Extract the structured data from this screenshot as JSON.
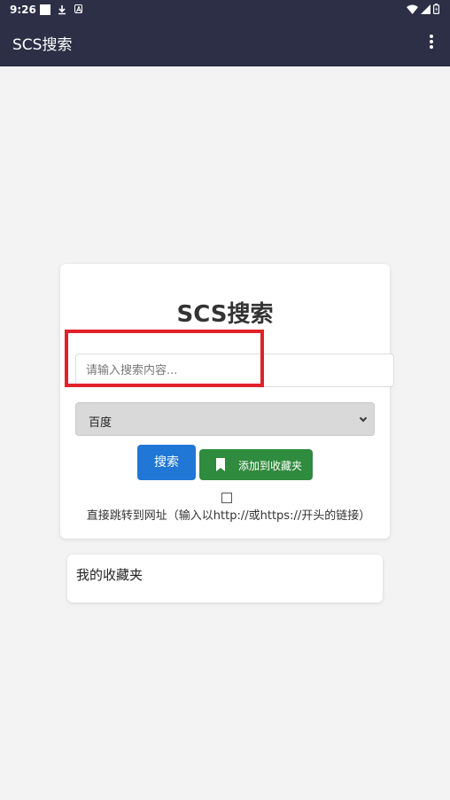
{
  "status_bar": {
    "time": "9:26",
    "left_icons": [
      "notification-square-icon",
      "download-icon",
      "font-a-icon"
    ],
    "right_icons": [
      "wifi-icon",
      "signal-icon",
      "battery-icon"
    ]
  },
  "app_bar": {
    "title": "SCS搜索",
    "menu_icon": "more-vert-icon"
  },
  "search_card": {
    "title": "SCS搜索",
    "search_placeholder": "请输入搜索内容...",
    "engine_selected": "百度",
    "search_button": "搜索",
    "favorite_button": "添加到收藏夹",
    "redirect_label": "直接跳转到网址（输入以http://或https://开头的链接）"
  },
  "favorites": {
    "title": "我的收藏夹"
  },
  "colors": {
    "app_bar_bg": "#2c2f45",
    "page_bg": "#f3f3f3",
    "search_button": "#2077d6",
    "favorite_button": "#2f8b3d",
    "highlight": "#e2212a"
  }
}
